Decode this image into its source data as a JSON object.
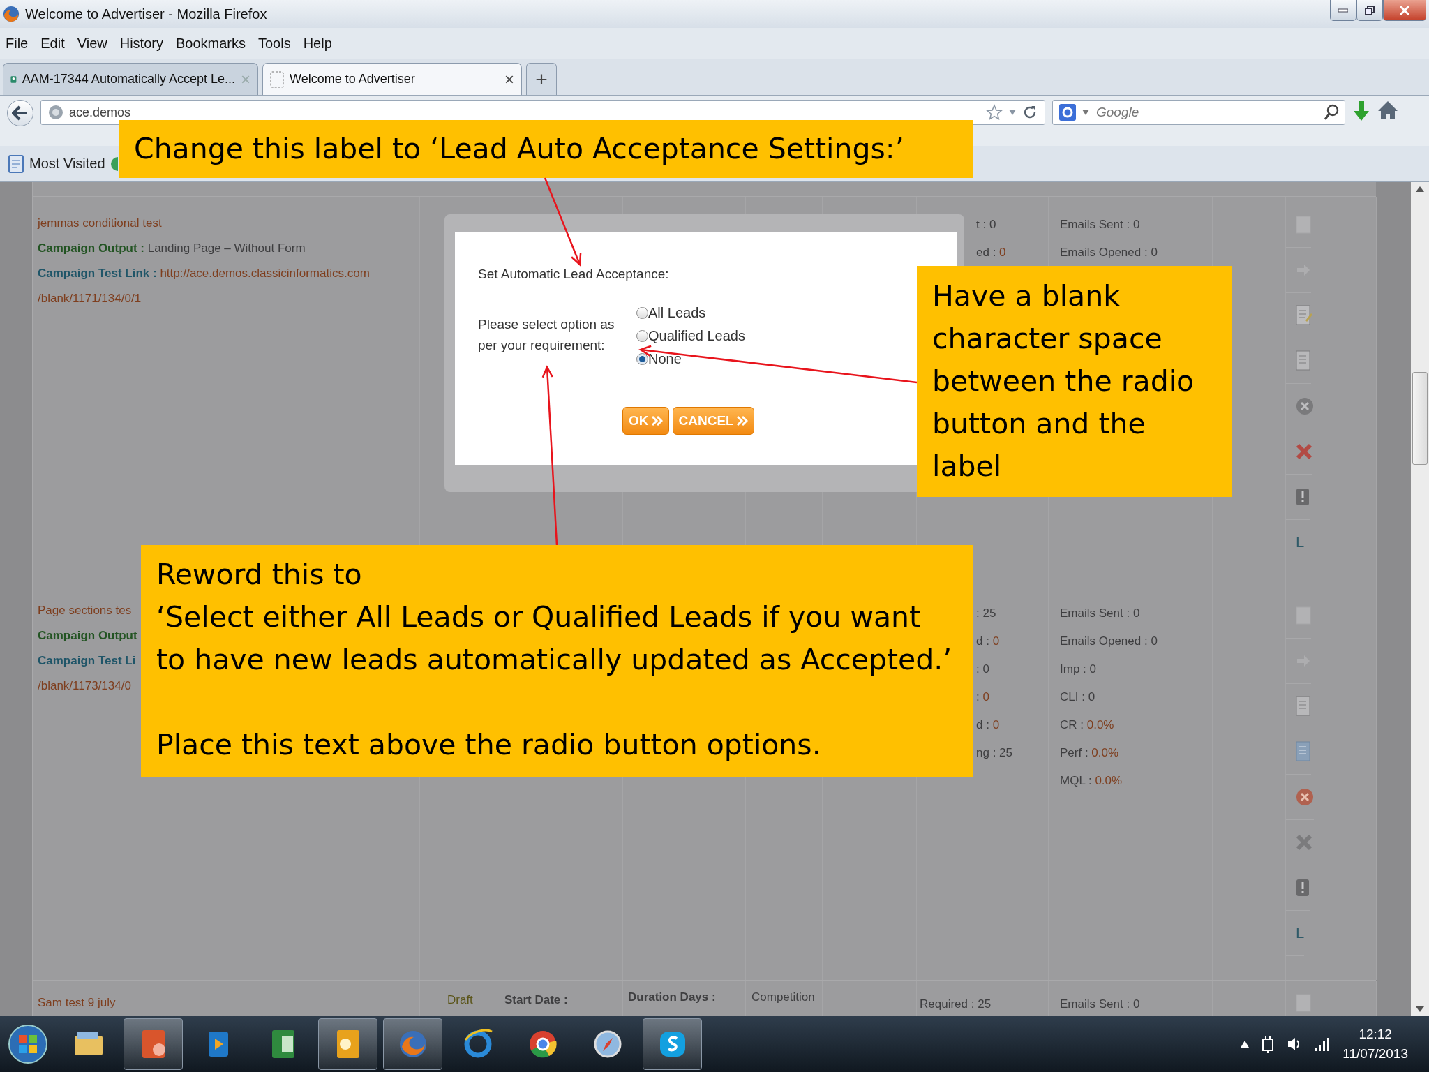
{
  "window": {
    "title": "Welcome to Advertiser - Mozilla Firefox"
  },
  "menu": [
    "File",
    "Edit",
    "View",
    "History",
    "Bookmarks",
    "Tools",
    "Help"
  ],
  "tabs": [
    {
      "label": "AAM-17344 Automatically Accept Le...",
      "close": "×",
      "selected": false
    },
    {
      "label": "Welcome to Advertiser",
      "close": "×",
      "selected": true
    }
  ],
  "new_tab": "+",
  "address_bar": {
    "value": "ace.demos"
  },
  "search": {
    "placeholder": "Google"
  },
  "bookmarks": [
    "Most Visited"
  ],
  "campaigns": [
    {
      "lines": [
        {
          "kind": "name",
          "value": "jemmas conditional test"
        },
        {
          "kind": "output",
          "label": "Campaign Output :",
          "value": " Landing Page – Without Form"
        },
        {
          "kind": "link",
          "label": "Campaign Test Link :",
          "value": " http://ace.demos.classicinformatics.com"
        },
        {
          "kind": "path",
          "value": "/blank/1171/134/0/1"
        }
      ],
      "stats": [
        {
          "label": "t : ",
          "value": "0",
          "kind": "plain"
        },
        {
          "label": "ed : ",
          "value": "0",
          "kind": "warn"
        }
      ],
      "emails": [
        {
          "label": "Emails Sent : ",
          "value": "0",
          "kind": "plain"
        },
        {
          "label": "Emails Opened : ",
          "value": "0",
          "kind": "plain"
        }
      ],
      "actions": [
        {
          "kind": "faded-document"
        },
        {
          "kind": "arrow"
        },
        {
          "kind": "edit-document"
        },
        {
          "kind": "document"
        },
        {
          "kind": "circle-x"
        },
        {
          "kind": "red-x"
        },
        {
          "kind": "alert"
        },
        {
          "kind": "letter",
          "text": "L"
        }
      ]
    },
    {
      "lines": [
        {
          "kind": "name",
          "value": "Page sections tes"
        },
        {
          "kind": "output",
          "label": "Campaign Output"
        },
        {
          "kind": "link",
          "label": "Campaign Test Li"
        },
        {
          "kind": "path",
          "value": "/blank/1173/134/0"
        }
      ],
      "stats": [
        {
          "label": ": ",
          "value": "25",
          "kind": "plain"
        },
        {
          "label": "d : ",
          "value": "0",
          "kind": "warn"
        },
        {
          "label": ": ",
          "value": "0",
          "kind": "plain"
        },
        {
          "label": ": ",
          "value": "0",
          "kind": "warn"
        },
        {
          "label": "d : ",
          "value": "0",
          "kind": "warn"
        },
        {
          "label": "ng : ",
          "value": "25",
          "kind": "plain"
        }
      ],
      "emails": [
        {
          "label": "Emails Sent : ",
          "value": "0",
          "kind": "plain"
        },
        {
          "label": "Emails Opened : ",
          "value": "0",
          "kind": "plain"
        },
        {
          "label": "Imp : ",
          "value": "0",
          "kind": "plain"
        },
        {
          "label": "CLI : ",
          "value": "0",
          "kind": "plain"
        },
        {
          "label": "CR : ",
          "value": "0.0%",
          "kind": "warn"
        },
        {
          "label": "Perf : ",
          "value": "0.0%",
          "kind": "warn"
        },
        {
          "label": "MQL : ",
          "value": "0.0%",
          "kind": "warn"
        }
      ],
      "actions": [
        {
          "kind": "faded-document"
        },
        {
          "kind": "arrow"
        },
        {
          "kind": "document"
        },
        {
          "kind": "blue-document"
        },
        {
          "kind": "red-circle-x"
        },
        {
          "kind": "grey-x"
        },
        {
          "kind": "alert"
        },
        {
          "kind": "letter",
          "text": "L"
        }
      ]
    },
    {
      "lines": [
        {
          "kind": "name",
          "value": "Sam test 9 july"
        }
      ],
      "status": "Draft",
      "start_date": "Start Date :",
      "duration": "Duration Days :",
      "competition": "Competition",
      "stats": [
        {
          "label": "Required : ",
          "value": "25",
          "kind": "plain"
        }
      ],
      "emails": [
        {
          "label": "Emails Sent : ",
          "value": "0",
          "kind": "plain"
        }
      ],
      "actions": [
        {
          "kind": "faded-document"
        }
      ]
    }
  ],
  "dialog": {
    "title": "Set Automatic Lead Acceptance:",
    "prompt": "Please select option as per your requirement:",
    "options": [
      {
        "label": "All Leads",
        "selected": false
      },
      {
        "label": "Qualified Leads",
        "selected": false
      },
      {
        "label": "None",
        "selected": true
      }
    ],
    "buttons": [
      "OK",
      "CANCEL"
    ]
  },
  "annotations": [
    {
      "paragraphs": [
        "Change this label to ‘Lead Auto Acceptance Settings:’"
      ]
    },
    {
      "paragraphs": [
        "Have a blank character space between the radio button and the label"
      ]
    },
    {
      "paragraphs": [
        "Reword this to",
        "‘Select either All Leads or Qualified Leads if you want to have new leads automatically updated as Accepted.’",
        "Place this text above the radio button options."
      ]
    }
  ],
  "taskbar": {
    "apps": [
      {
        "kind": "explorer",
        "running": false
      },
      {
        "kind": "powerpoint",
        "running": true
      },
      {
        "kind": "media",
        "running": false
      },
      {
        "kind": "excel",
        "running": false
      },
      {
        "kind": "outlook",
        "running": true
      },
      {
        "kind": "firefox",
        "running": true
      },
      {
        "kind": "ie",
        "running": false
      },
      {
        "kind": "chrome",
        "running": false
      },
      {
        "kind": "safari",
        "running": false
      },
      {
        "kind": "skype",
        "running": true
      }
    ],
    "clock": {
      "time": "12:12",
      "date": "11/07/2013"
    }
  }
}
